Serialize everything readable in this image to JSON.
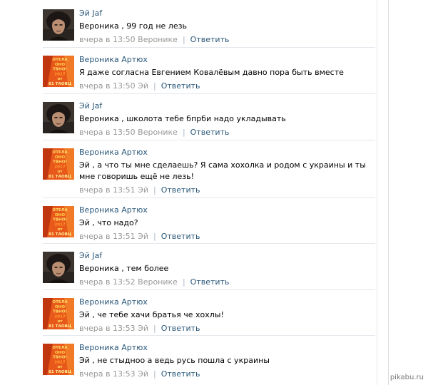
{
  "colors": {
    "link": "#2b587a",
    "meta": "#999999",
    "separator": "#e4e8ed"
  },
  "comments": [
    {
      "author": "Эй Jaf",
      "avatar": "man-portrait",
      "text": "Вероника , 99 год не лезь",
      "time": "вчера в 13:50",
      "reply_to": "Веронике",
      "reply_label": "Ответить"
    },
    {
      "author": "Вероника Артюх",
      "avatar": "orange-poster",
      "text": "Я даже согласна Евгением Ковалёвым давно пора быть вместе",
      "time": "вчера в 13:50",
      "reply_to": "Эй",
      "reply_label": "Ответить"
    },
    {
      "author": "Эй Jaf",
      "avatar": "man-portrait",
      "text": "Вероника , школота тебе бпрби надо укладывать",
      "time": "вчера в 13:50",
      "reply_to": "Веронике",
      "reply_label": "Ответить"
    },
    {
      "author": "Вероника Артюх",
      "avatar": "orange-poster",
      "text": "Эй , а что ты мне сделаешь? Я сама хохолка и родом с украины и ты мне говоришь ещё не лезь!",
      "time": "вчера в 13:51",
      "reply_to": "Эй",
      "reply_label": "Ответить"
    },
    {
      "author": "Вероника Артюх",
      "avatar": "orange-poster",
      "text": "Эй , что надо?",
      "time": "вчера в 13:51",
      "reply_to": "Эй",
      "reply_label": "Ответить"
    },
    {
      "author": "Эй Jaf",
      "avatar": "man-portrait",
      "text": "Вероника , тем более",
      "time": "вчера в 13:52",
      "reply_to": "Веронике",
      "reply_label": "Ответить"
    },
    {
      "author": "Вероника Артюх",
      "avatar": "orange-poster",
      "text": "Эй , че тебе хачи братья че хохлы!",
      "time": "вчера в 13:53",
      "reply_to": "Эй",
      "reply_label": "Ответить"
    },
    {
      "author": "Вероника Артюх",
      "avatar": "orange-poster",
      "text": "Эй , не стыдноо а ведь русь пошла с украины",
      "time": "вчера в 13:53",
      "reply_to": "Эй",
      "reply_label": "Ответить"
    }
  ],
  "poster_text": [
    "ОТЕЛА",
    "ОНО",
    "ТВНО!",
    "2017",
    "от",
    "81 ТАОВЦ"
  ],
  "watermark": "pikabu.ru"
}
